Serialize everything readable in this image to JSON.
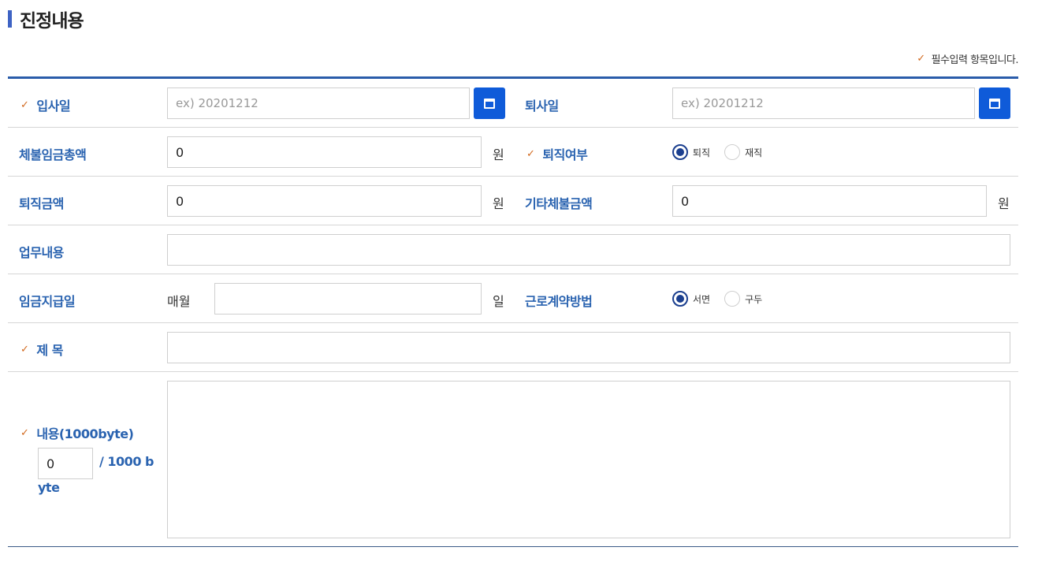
{
  "section": {
    "title": "진정내용"
  },
  "required_note": "필수입력 항목입니다.",
  "fields": {
    "join_date": {
      "label": "입사일",
      "placeholder": "ex) 20201212"
    },
    "leave_date": {
      "label": "퇴사일",
      "placeholder": "ex) 20201212"
    },
    "unpaid_total": {
      "label": "체불임금총액",
      "value": "0",
      "unit": "원"
    },
    "retired": {
      "label": "퇴직여부",
      "options": [
        "퇴직",
        "재직"
      ],
      "selected": "퇴직"
    },
    "severance": {
      "label": "퇴직금액",
      "value": "0",
      "unit": "원"
    },
    "other_unpaid": {
      "label": "기타체불금액",
      "value": "0",
      "unit": "원"
    },
    "job_desc": {
      "label": "업무내용",
      "value": ""
    },
    "pay_day": {
      "label": "임금지급일",
      "prefix": "매월",
      "value": "",
      "unit": "일"
    },
    "contract_method": {
      "label": "근로계약방법",
      "options": [
        "서면",
        "구두"
      ],
      "selected": "서면"
    },
    "subject": {
      "label": "제 목",
      "value": ""
    },
    "content": {
      "label": "내용(1000byte)",
      "byte_count": "0",
      "byte_limit_line1": "/ 1000 b",
      "byte_limit_line2": "yte"
    }
  },
  "icons": {
    "check": "✓",
    "calendar": "calendar-icon"
  },
  "colors": {
    "accent": "#2a63b0",
    "button": "#0f5bd9",
    "check": "#d2691e"
  }
}
